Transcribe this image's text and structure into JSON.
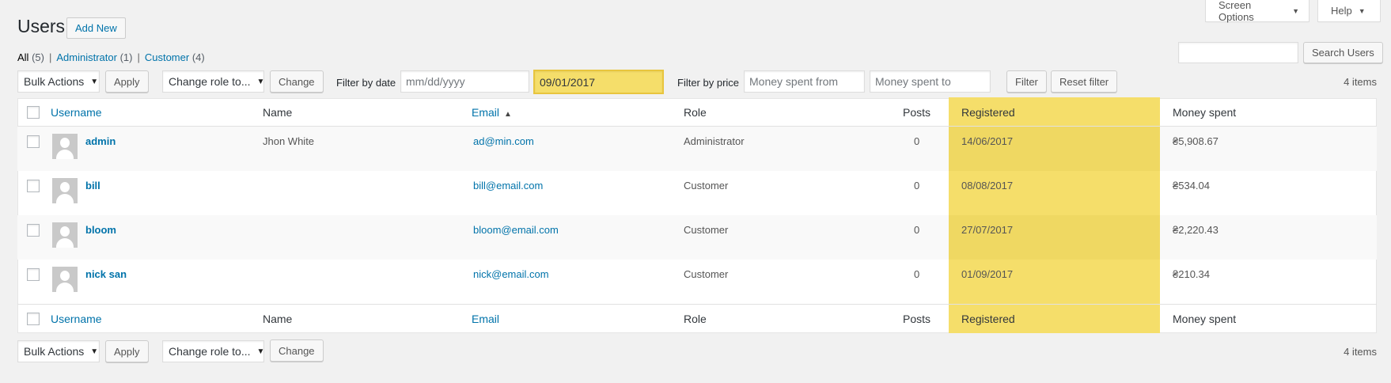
{
  "screen_meta": {
    "screen_options": "Screen Options",
    "help": "Help"
  },
  "page": {
    "title": "Users",
    "add_new": "Add New"
  },
  "views": {
    "all": "All",
    "all_count": "(5)",
    "administrator": "Administrator",
    "administrator_count": "(1)",
    "customer": "Customer",
    "customer_count": "(4)",
    "separator": "|"
  },
  "search": {
    "value": "",
    "button": "Search Users"
  },
  "tablenav_top": {
    "bulk_actions": "Bulk Actions",
    "apply": "Apply",
    "change_role": "Change role to...",
    "change": "Change",
    "filter_by_date_label": "Filter by date",
    "date_from_placeholder": "mm/dd/yyyy",
    "date_to_value": "09/01/2017",
    "filter_by_price_label": "Filter by price",
    "price_from_placeholder": "Money spent from",
    "price_to_placeholder": "Money spent to",
    "filter": "Filter",
    "reset_filter": "Reset filter",
    "items_count": "4 items"
  },
  "columns": {
    "username": "Username",
    "name": "Name",
    "email": "Email",
    "role": "Role",
    "posts": "Posts",
    "registered": "Registered",
    "money_spent": "Money spent"
  },
  "rows": [
    {
      "username": "admin",
      "name": "Jhon White",
      "email": "ad@min.com",
      "role": "Administrator",
      "posts": "0",
      "registered": "14/06/2017",
      "money_spent": "₴5,908.67"
    },
    {
      "username": "bill",
      "name": "",
      "email": "bill@email.com",
      "role": "Customer",
      "posts": "0",
      "registered": "08/08/2017",
      "money_spent": "₴534.04"
    },
    {
      "username": "bloom",
      "name": "",
      "email": "bloom@email.com",
      "role": "Customer",
      "posts": "0",
      "registered": "27/07/2017",
      "money_spent": "₴2,220.43"
    },
    {
      "username": "nick san",
      "name": "",
      "email": "nick@email.com",
      "role": "Customer",
      "posts": "0",
      "registered": "01/09/2017",
      "money_spent": "₴210.34"
    }
  ],
  "tablenav_bottom": {
    "bulk_actions": "Bulk Actions",
    "apply": "Apply",
    "change_role": "Change role to...",
    "change": "Change",
    "items_count": "4 items"
  },
  "colors": {
    "highlight": "#f5de6a",
    "link": "#0073aa",
    "background": "#f1f1f1"
  }
}
